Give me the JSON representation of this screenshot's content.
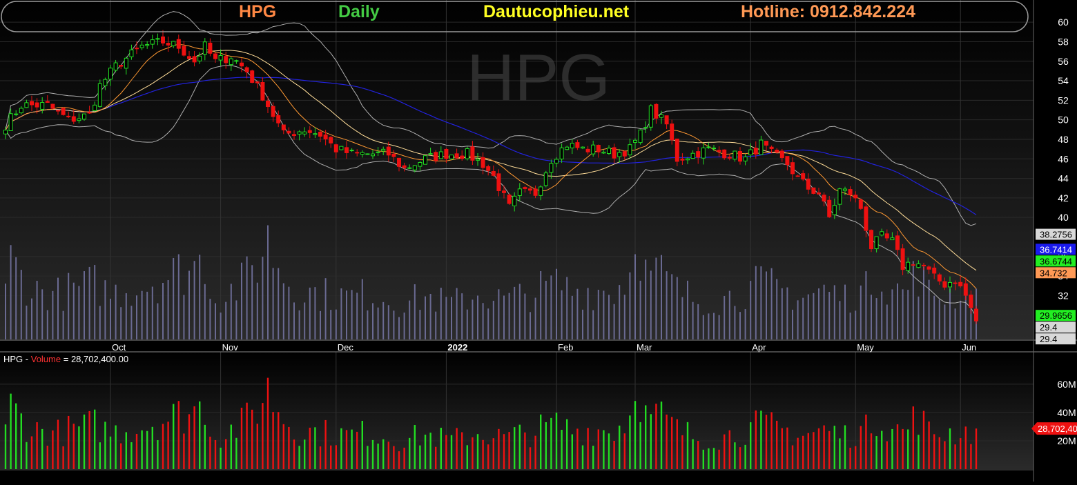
{
  "header": {
    "symbol": "HPG",
    "interval": "Daily",
    "site": "Dautucophieu.net",
    "hotline": "Hotline: 0912.842.224",
    "watermark": "HPG"
  },
  "colors": {
    "background": "#000000",
    "up_candle": "#22dd22",
    "down_candle": "#ee1111",
    "sma_short": "#ff9933",
    "sma_mid": "#ffdd99",
    "sma_long": "#2222dd",
    "bollinger": "#b0b0b0",
    "volume_overlay": "#6a6a92",
    "symbol_color": "#ff8844",
    "interval_color": "#44cc44",
    "site_color": "#ffff22",
    "hotline_color": "#ff9955"
  },
  "volume_panel": {
    "symbol": "HPG",
    "separator": " - ",
    "label": "Volume",
    "equals": " = ",
    "value_text": "28,702,400.00"
  },
  "chart_data": [
    {
      "type": "candlestick",
      "title": "HPG Daily",
      "ylim": [
        28,
        61
      ],
      "y_ticks": [
        60,
        58,
        56,
        54,
        52,
        50,
        48,
        46,
        44,
        42,
        40,
        36,
        34,
        32,
        30
      ],
      "x_labels": [
        {
          "label": "Oct",
          "bar": 20
        },
        {
          "label": "Nov",
          "bar": 41
        },
        {
          "label": "Dec",
          "bar": 63
        },
        {
          "label": "2022",
          "bar": 84,
          "bold": true
        },
        {
          "label": "Feb",
          "bar": 105
        },
        {
          "label": "Mar",
          "bar": 120
        },
        {
          "label": "Apr",
          "bar": 142
        },
        {
          "label": "May",
          "bar": 162
        },
        {
          "label": "Jun",
          "bar": 182
        }
      ],
      "price_keys": [
        [
          0,
          49.5
        ],
        [
          3,
          51.5
        ],
        [
          8,
          51.5
        ],
        [
          12,
          50
        ],
        [
          16,
          50.5
        ],
        [
          18,
          53.5
        ],
        [
          21,
          55.5
        ],
        [
          26,
          57.5
        ],
        [
          30,
          58
        ],
        [
          33,
          57.5
        ],
        [
          36,
          56
        ],
        [
          38,
          57.5
        ],
        [
          40,
          56
        ],
        [
          43,
          56.5
        ],
        [
          46,
          55
        ],
        [
          49,
          52.5
        ],
        [
          53,
          48.5
        ],
        [
          57,
          49
        ],
        [
          60,
          48.5
        ],
        [
          63,
          47
        ],
        [
          66,
          46.5
        ],
        [
          70,
          46.5
        ],
        [
          73,
          46.5
        ],
        [
          76,
          45
        ],
        [
          80,
          46
        ],
        [
          84,
          46.5
        ],
        [
          88,
          46.5
        ],
        [
          91,
          45.5
        ],
        [
          93,
          44.2
        ],
        [
          96,
          41
        ],
        [
          98,
          42.5
        ],
        [
          101,
          42.5
        ],
        [
          104,
          46
        ],
        [
          107,
          47.5
        ],
        [
          110,
          47
        ],
        [
          113,
          47
        ],
        [
          116,
          46.5
        ],
        [
          119,
          47
        ],
        [
          121,
          48.5
        ],
        [
          123,
          51
        ],
        [
          125,
          50
        ],
        [
          126,
          49.5
        ],
        [
          128,
          46
        ],
        [
          131,
          46.5
        ],
        [
          134,
          47
        ],
        [
          138,
          46.5
        ],
        [
          141,
          46
        ],
        [
          144,
          47.5
        ],
        [
          146,
          46.5
        ],
        [
          149,
          45.5
        ],
        [
          151,
          44
        ],
        [
          153,
          43
        ],
        [
          155,
          42.5
        ],
        [
          157,
          40
        ],
        [
          159,
          42.8
        ],
        [
          161,
          42.5
        ],
        [
          163,
          41
        ],
        [
          165,
          37
        ],
        [
          167,
          38
        ],
        [
          169,
          37.5
        ],
        [
          171,
          35
        ],
        [
          173,
          35.5
        ],
        [
          175,
          35
        ],
        [
          177,
          33.8
        ],
        [
          179,
          33.2
        ],
        [
          181,
          33.6
        ],
        [
          183,
          32
        ],
        [
          185,
          29.4
        ]
      ],
      "last_values": [
        {
          "text": "38.2756",
          "value": 38.2756,
          "series": "Bollinger upper",
          "color": "#d8d8d8",
          "text_color": "#000000"
        },
        {
          "text": "36.7414",
          "value": 36.7414,
          "series": "SMA long",
          "color": "#1a1aee",
          "text_color": "#ffffff"
        },
        {
          "text": "36.6744",
          "value": 36.6744,
          "series": "SMA mid",
          "color": "#22ee22",
          "text_color": "#000000"
        },
        {
          "text": "34.732",
          "value": 34.732,
          "series": "SMA short",
          "color": "#ff9955",
          "text_color": "#000000"
        },
        {
          "text": "29.9656",
          "value": 29.9656,
          "series": "Bollinger lower",
          "color": "#22ee22",
          "text_color": "#000000"
        },
        {
          "text": "29.4",
          "value": 29.4,
          "series": "Close",
          "color": "#d8d8d8",
          "text_color": "#000000"
        },
        {
          "text": "29.4",
          "value": 29.4,
          "series": "Last",
          "color": "#d8d8d8",
          "text_color": "#000000"
        }
      ]
    },
    {
      "type": "bar",
      "title": "HPG - Volume = 28,702,400.00",
      "ylabel": "Volume",
      "ylim": [
        0,
        78000000
      ],
      "y_ticks": [
        {
          "value": 60000000,
          "label": "60M"
        },
        {
          "value": 40000000,
          "label": "40M"
        },
        {
          "value": 20000000,
          "label": "20M"
        }
      ],
      "last": {
        "value": 28702400,
        "label": "28,702,400"
      },
      "volume_keys": [
        [
          0,
          28
        ],
        [
          1,
          48
        ],
        [
          5,
          30
        ],
        [
          10,
          28
        ],
        [
          17,
          34
        ],
        [
          20,
          28
        ],
        [
          25,
          32
        ],
        [
          32,
          40
        ],
        [
          38,
          48
        ],
        [
          40,
          24
        ],
        [
          45,
          34
        ],
        [
          48,
          48
        ],
        [
          50,
          60
        ],
        [
          52,
          46
        ],
        [
          55,
          30
        ],
        [
          60,
          28
        ],
        [
          65,
          26
        ],
        [
          70,
          28
        ],
        [
          75,
          22
        ],
        [
          80,
          26
        ],
        [
          85,
          22
        ],
        [
          90,
          28
        ],
        [
          95,
          24
        ],
        [
          100,
          28
        ],
        [
          105,
          34
        ],
        [
          108,
          30
        ],
        [
          112,
          30
        ],
        [
          116,
          30
        ],
        [
          119,
          40
        ],
        [
          120,
          77
        ],
        [
          122,
          40
        ],
        [
          125,
          40
        ],
        [
          128,
          30
        ],
        [
          132,
          24
        ],
        [
          136,
          24
        ],
        [
          140,
          28
        ],
        [
          144,
          34
        ],
        [
          148,
          30
        ],
        [
          152,
          26
        ],
        [
          156,
          30
        ],
        [
          160,
          26
        ],
        [
          164,
          30
        ],
        [
          166,
          42
        ],
        [
          168,
          34
        ],
        [
          171,
          28
        ],
        [
          174,
          42
        ],
        [
          176,
          28
        ],
        [
          180,
          28
        ],
        [
          184,
          29
        ]
      ]
    }
  ]
}
